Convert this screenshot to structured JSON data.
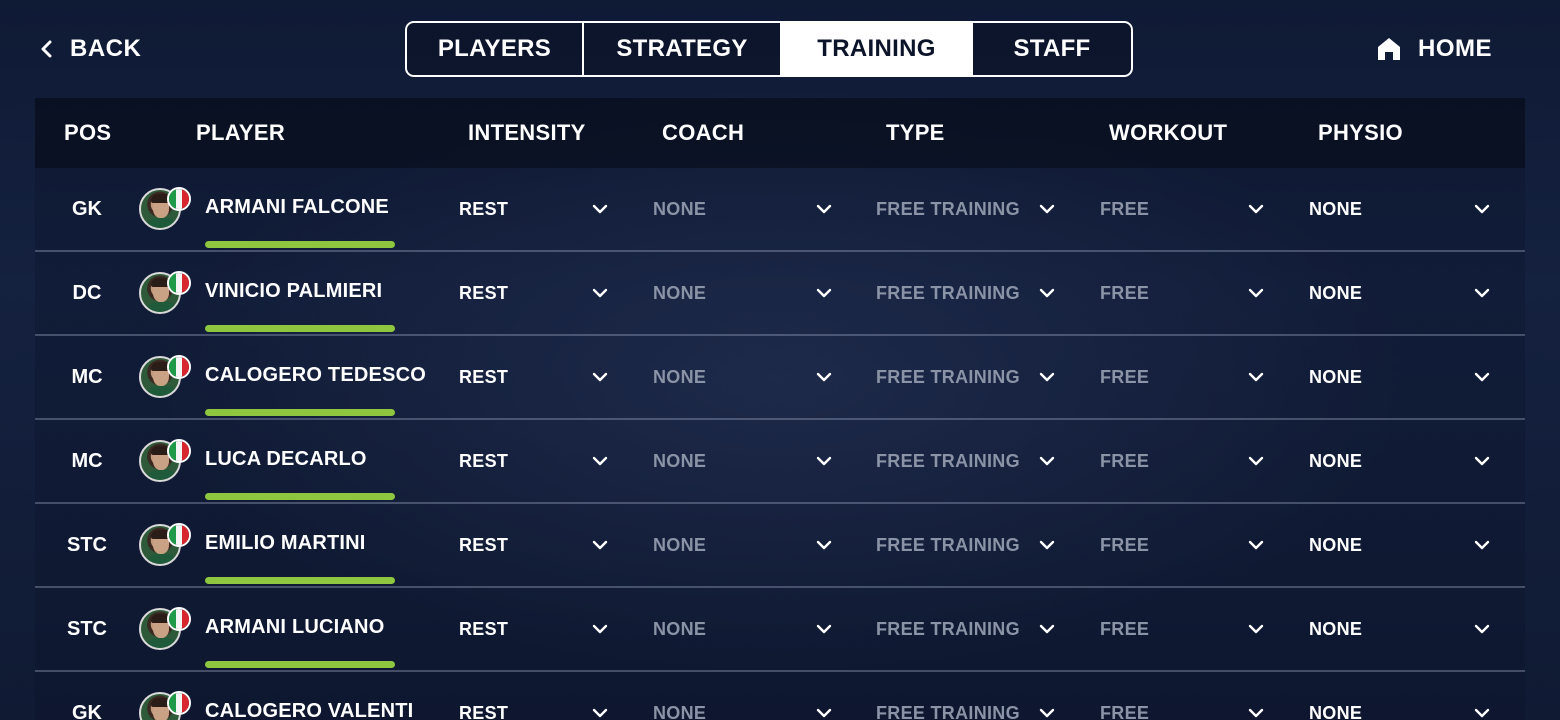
{
  "nav": {
    "back_label": "BACK",
    "home_label": "HOME",
    "tabs": [
      {
        "label": "PLAYERS",
        "active": false
      },
      {
        "label": "STRATEGY",
        "active": false
      },
      {
        "label": "TRAINING",
        "active": true
      },
      {
        "label": "STAFF",
        "active": false
      }
    ]
  },
  "table": {
    "headers": {
      "pos": "POS",
      "player": "PLAYER",
      "intensity": "INTENSITY",
      "coach": "COACH",
      "type": "TYPE",
      "workout": "WORKOUT",
      "physio": "PHYSIO"
    },
    "rows": [
      {
        "pos": "GK",
        "name": "ARMANI FALCONE",
        "nationality": "Italy",
        "intensity": "REST",
        "coach": "NONE",
        "type": "FREE TRAINING",
        "workout": "FREE",
        "physio": "NONE"
      },
      {
        "pos": "DC",
        "name": "VINICIO PALMIERI",
        "nationality": "Italy",
        "intensity": "REST",
        "coach": "NONE",
        "type": "FREE TRAINING",
        "workout": "FREE",
        "physio": "NONE"
      },
      {
        "pos": "MC",
        "name": "CALOGERO TEDESCO",
        "nationality": "Italy",
        "intensity": "REST",
        "coach": "NONE",
        "type": "FREE TRAINING",
        "workout": "FREE",
        "physio": "NONE"
      },
      {
        "pos": "MC",
        "name": "LUCA DECARLO",
        "nationality": "Italy",
        "intensity": "REST",
        "coach": "NONE",
        "type": "FREE TRAINING",
        "workout": "FREE",
        "physio": "NONE"
      },
      {
        "pos": "STC",
        "name": "EMILIO MARTINI",
        "nationality": "Italy",
        "intensity": "REST",
        "coach": "NONE",
        "type": "FREE TRAINING",
        "workout": "FREE",
        "physio": "NONE"
      },
      {
        "pos": "STC",
        "name": "ARMANI LUCIANO",
        "nationality": "Italy",
        "intensity": "REST",
        "coach": "NONE",
        "type": "FREE TRAINING",
        "workout": "FREE",
        "physio": "NONE"
      },
      {
        "pos": "GK",
        "name": "CALOGERO VALENTI",
        "nationality": "Italy",
        "intensity": "REST",
        "coach": "NONE",
        "type": "FREE TRAINING",
        "workout": "FREE",
        "physio": "NONE"
      }
    ]
  },
  "colors": {
    "accent_bar": "#8ec63f",
    "background": "#14213f",
    "dim_text": "#8b93a6"
  },
  "icons": {
    "back": "chevron-left-icon",
    "home": "home-icon",
    "dropdown": "chevron-down-icon",
    "flag": "italy-flag-icon"
  }
}
